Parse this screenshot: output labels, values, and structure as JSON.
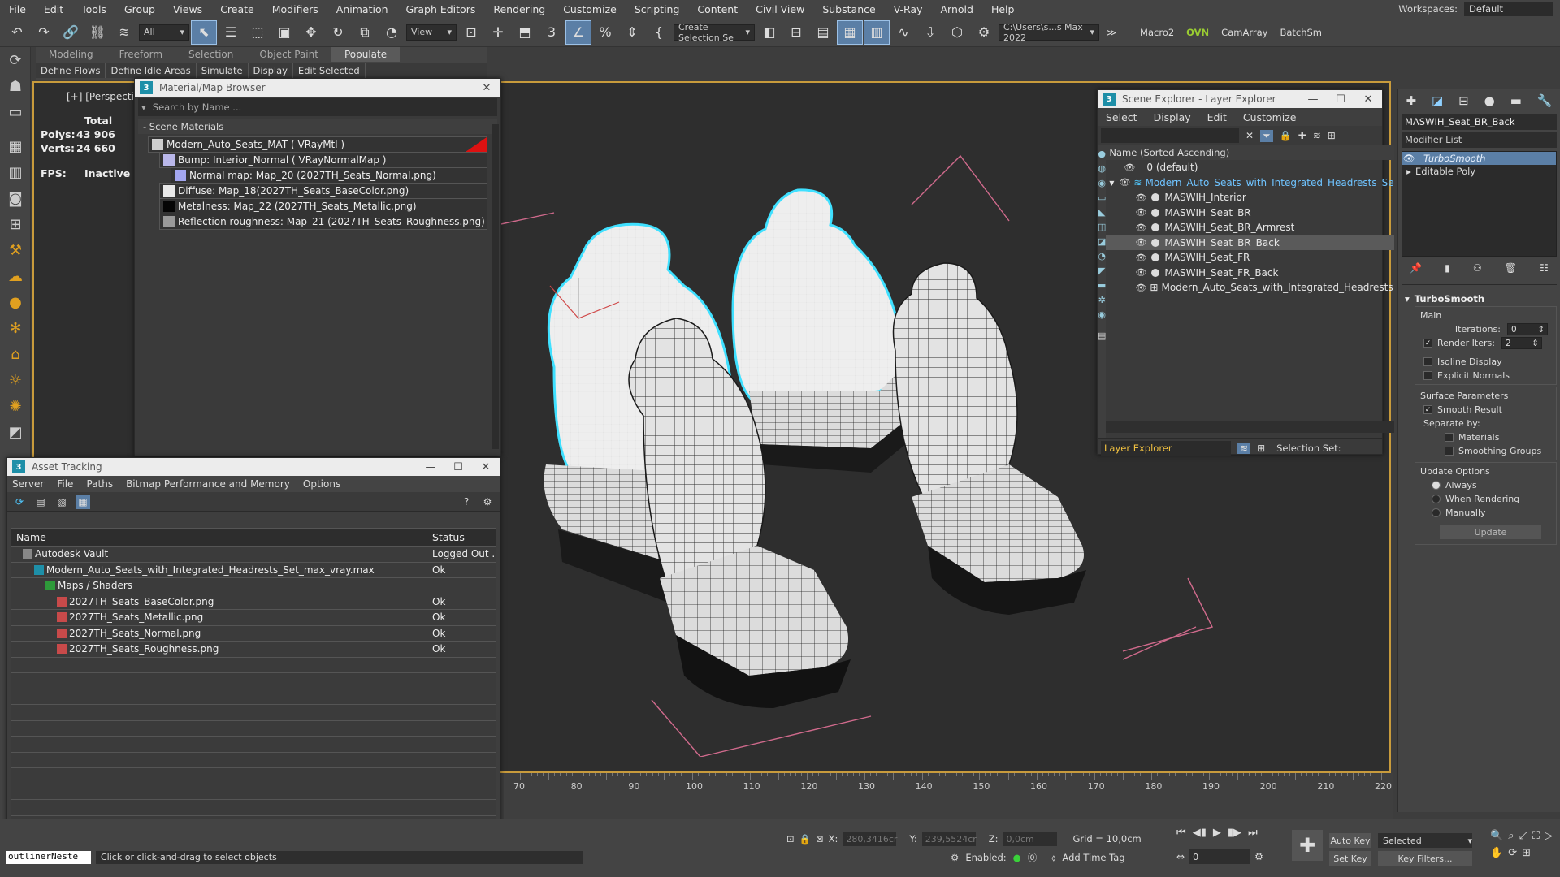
{
  "menu": [
    "File",
    "Edit",
    "Tools",
    "Group",
    "Views",
    "Create",
    "Modifiers",
    "Animation",
    "Graph Editors",
    "Rendering",
    "Customize",
    "Scripting",
    "Content",
    "Civil View",
    "Substance",
    "V-Ray",
    "Arnold",
    "Help"
  ],
  "workspace": {
    "label": "Workspaces:",
    "value": "Default"
  },
  "toolbar": {
    "filter": "All",
    "view": "View",
    "selection_set": "Create Selection Se",
    "path": "C:\\Users\\s...s Max 2022",
    "macro": "Macro2",
    "ovn": "OVN",
    "camarray": "CamArray",
    "batchsm": "BatchSm"
  },
  "ribbon": {
    "tabs": [
      "Modeling",
      "Freeform",
      "Selection",
      "Object Paint",
      "Populate"
    ],
    "active": "Populate",
    "sub": [
      "Define Flows",
      "Define Idle Areas",
      "Simulate",
      "Display",
      "Edit Selected"
    ]
  },
  "viewport": {
    "label": "[+] [Perspective ] [St",
    "stats": {
      "total": "Total",
      "polys_label": "Polys:",
      "polys": "43 906",
      "verts_label": "Verts:",
      "verts": "24 660",
      "fps_label": "FPS:",
      "fps": "Inactive"
    }
  },
  "material_browser": {
    "title": "Material/Map Browser",
    "search": "Search by Name ...",
    "group": "- Scene Materials",
    "items": [
      {
        "label": "Modern_Auto_Seats_MAT  ( VRayMtl )",
        "indent": 0,
        "swatch": "#cfcfcf"
      },
      {
        "label": "Bump: Interior_Normal  ( VRayNormalMap )",
        "indent": 1,
        "swatch": "#b9b7e9"
      },
      {
        "label": "Normal map: Map_20 (2027TH_Seats_Normal.png)",
        "indent": 2,
        "swatch": "#a3a6f0"
      },
      {
        "label": "Diffuse: Map_18(2027TH_Seats_BaseColor.png)",
        "indent": 1,
        "swatch": "#e9e9e9"
      },
      {
        "label": "Metalness: Map_22 (2027TH_Seats_Metallic.png)",
        "indent": 1,
        "swatch": "#050505"
      },
      {
        "label": "Reflection roughness: Map_21 (2027TH_Seats_Roughness.png)",
        "indent": 1,
        "swatch": "#9a9a9a"
      }
    ]
  },
  "asset_tracking": {
    "title": "Asset Tracking",
    "menu": [
      "Server",
      "File",
      "Paths",
      "Bitmap Performance and Memory",
      "Options"
    ],
    "columns": {
      "name": "Name",
      "status": "Status"
    },
    "rows": [
      {
        "name": "Autodesk Vault",
        "status": "Logged Out ..",
        "indent": 1
      },
      {
        "name": "Modern_Auto_Seats_with_Integrated_Headrests_Set_max_vray.max",
        "status": "Ok",
        "indent": 2
      },
      {
        "name": "Maps / Shaders",
        "status": "",
        "indent": 3
      },
      {
        "name": "2027TH_Seats_BaseColor.png",
        "status": "Ok",
        "indent": 4
      },
      {
        "name": "2027TH_Seats_Metallic.png",
        "status": "Ok",
        "indent": 4
      },
      {
        "name": "2027TH_Seats_Normal.png",
        "status": "Ok",
        "indent": 4
      },
      {
        "name": "2027TH_Seats_Roughness.png",
        "status": "Ok",
        "indent": 4
      }
    ],
    "empty_rows": 11
  },
  "scene_explorer": {
    "title": "Scene Explorer - Layer Explorer",
    "menu": [
      "Select",
      "Display",
      "Edit",
      "Customize"
    ],
    "column": "Name (Sorted Ascending)",
    "rows": [
      {
        "name": "0 (default)",
        "indent": 1,
        "sel": false,
        "kind": "layer"
      },
      {
        "name": "Modern_Auto_Seats_with_Integrated_Headrests_Se",
        "indent": 0,
        "sel": false,
        "kind": "layerblue"
      },
      {
        "name": "MASWIH_Interior",
        "indent": 2,
        "sel": false,
        "kind": "obj"
      },
      {
        "name": "MASWIH_Seat_BR",
        "indent": 2,
        "sel": false,
        "kind": "obj"
      },
      {
        "name": "MASWIH_Seat_BR_Armrest",
        "indent": 2,
        "sel": false,
        "kind": "obj"
      },
      {
        "name": "MASWIH_Seat_BR_Back",
        "indent": 2,
        "sel": true,
        "kind": "obj"
      },
      {
        "name": "MASWIH_Seat_FR",
        "indent": 2,
        "sel": false,
        "kind": "obj"
      },
      {
        "name": "MASWIH_Seat_FR_Back",
        "indent": 2,
        "sel": false,
        "kind": "obj"
      },
      {
        "name": "Modern_Auto_Seats_with_Integrated_Headrests",
        "indent": 2,
        "sel": false,
        "kind": "grp"
      }
    ],
    "footer_dropdown": "Layer Explorer",
    "selection_set": "Selection Set:"
  },
  "command_panel": {
    "object_name": "MASWIH_Seat_BR_Back",
    "modifier_list": "Modifier List",
    "stack": [
      "TurboSmooth",
      "Editable Poly"
    ],
    "rollout_title": "TurboSmooth",
    "main": "Main",
    "iterations_label": "Iterations:",
    "iterations": "0",
    "render_iters_label": "Render Iters:",
    "render_iters": "2",
    "isoline": "Isoline Display",
    "explicit": "Explicit Normals",
    "surface": "Surface Parameters",
    "smooth_result": "Smooth Result",
    "separate_by": "Separate by:",
    "materials": "Materials",
    "smoothing_groups": "Smoothing Groups",
    "update_options": "Update Options",
    "always": "Always",
    "when_rendering": "When Rendering",
    "manually": "Manually",
    "update_button": "Update"
  },
  "timeline": {
    "ticks": [
      "70",
      "80",
      "90",
      "100",
      "110",
      "120",
      "130",
      "140",
      "150",
      "160",
      "170",
      "180",
      "190",
      "200",
      "210",
      "220"
    ]
  },
  "status": {
    "script_box": "outlinerNeste",
    "prompt": "Click or click-and-drag to select objects",
    "x_label": "X:",
    "x": "280,3416cr",
    "y_label": "Y:",
    "y": "239,5524cr",
    "z_label": "Z:",
    "z": "0,0cm",
    "grid": "Grid = 10,0cm",
    "enabled": "Enabled:",
    "add_time_tag": "Add Time Tag",
    "auto_key": "Auto Key",
    "selected": "Selected",
    "set_key": "Set Key",
    "key_filters": "Key Filters...",
    "frame": "0"
  },
  "colors": {
    "accent": "#5b7fa6",
    "viewport_border": "#c89b3c",
    "selection_cyan": "#3fe0ff"
  }
}
